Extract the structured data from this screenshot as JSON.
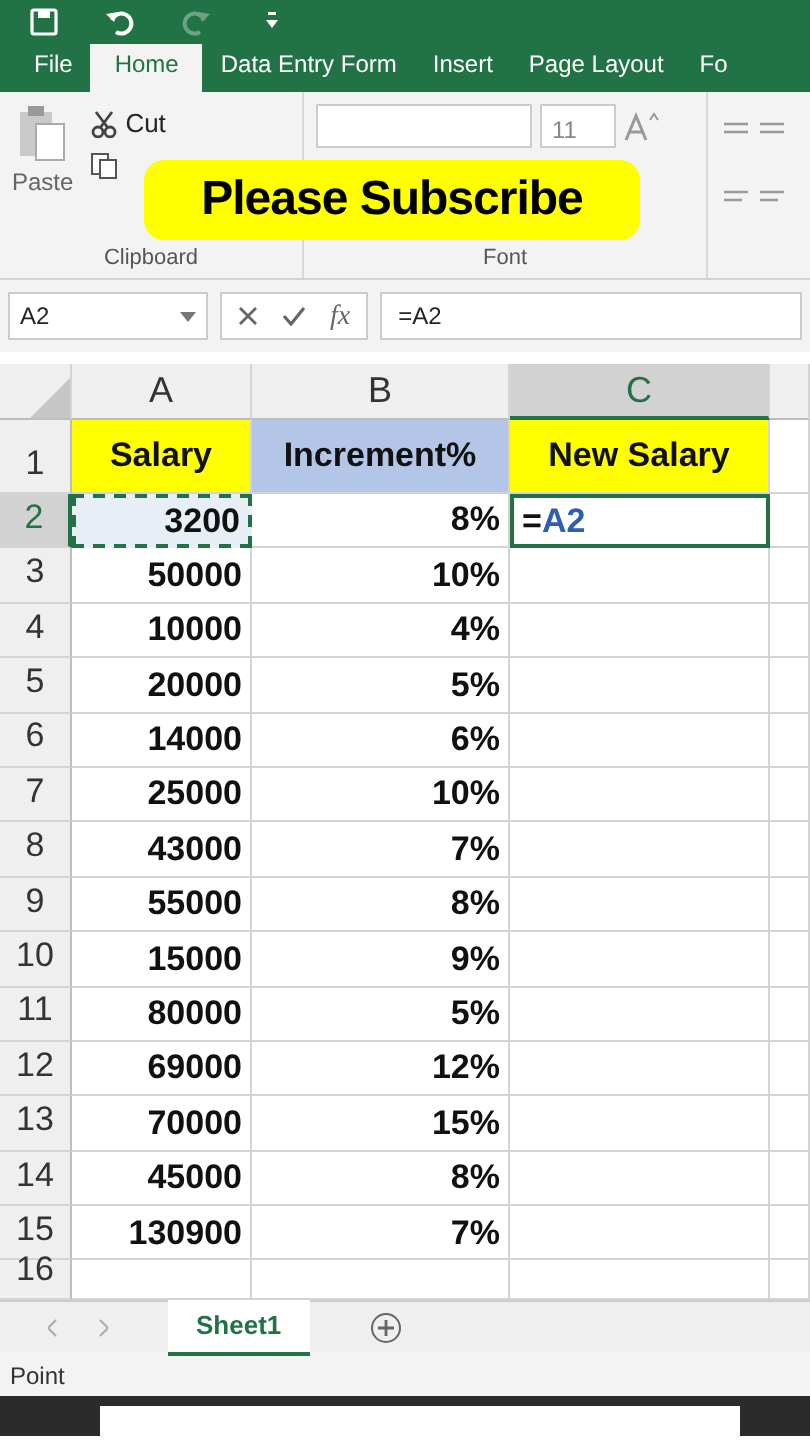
{
  "tabs": [
    {
      "label": "File",
      "selected": false
    },
    {
      "label": "Home",
      "selected": true
    },
    {
      "label": "Data Entry Form",
      "selected": false
    },
    {
      "label": "Insert",
      "selected": false
    },
    {
      "label": "Page Layout",
      "selected": false
    },
    {
      "label": "Fo",
      "selected": false
    }
  ],
  "ribbon": {
    "paste_label": "Paste",
    "cut_label": "Cut",
    "font_size": "11",
    "groups": [
      "Clipboard",
      "Font"
    ]
  },
  "overlay_banner": {
    "text": "Please Subscribe"
  },
  "formula_bar": {
    "name_box": "A2",
    "function_label": "fx",
    "value": "=A2"
  },
  "columns": [
    {
      "label": "A",
      "selected": false
    },
    {
      "label": "B",
      "selected": false
    },
    {
      "label": "C",
      "selected": true
    }
  ],
  "rows": [
    {
      "label": "1",
      "selected": false,
      "cells": [
        {
          "text": "Salary",
          "color": "#ffff00"
        },
        {
          "text": "Increment%",
          "color": "#b4c6e7"
        },
        {
          "text": "New Salary",
          "color": "#ffff00"
        }
      ]
    },
    {
      "label": "2",
      "selected": true,
      "cells": [
        {
          "text": "3200",
          "referenced": true
        },
        {
          "text": "8%"
        },
        {
          "prefix": "=",
          "ref": "A2",
          "selected": true
        }
      ]
    },
    {
      "label": "3",
      "selected": false,
      "cells": [
        {
          "text": "50000"
        },
        {
          "text": "10%"
        },
        {}
      ]
    },
    {
      "label": "4",
      "selected": false,
      "cells": [
        {
          "text": "10000"
        },
        {
          "text": "4%"
        },
        {}
      ]
    },
    {
      "label": "5",
      "selected": false,
      "cells": [
        {
          "text": "20000"
        },
        {
          "text": "5%"
        },
        {}
      ]
    },
    {
      "label": "6",
      "selected": false,
      "cells": [
        {
          "text": "14000"
        },
        {
          "text": "6%"
        },
        {}
      ]
    },
    {
      "label": "7",
      "selected": false,
      "cells": [
        {
          "text": "25000"
        },
        {
          "text": "10%"
        },
        {}
      ]
    },
    {
      "label": "8",
      "selected": false,
      "cells": [
        {
          "text": "43000"
        },
        {
          "text": "7%"
        },
        {}
      ]
    },
    {
      "label": "9",
      "selected": false,
      "cells": [
        {
          "text": "55000"
        },
        {
          "text": "8%"
        },
        {}
      ]
    },
    {
      "label": "10",
      "selected": false,
      "cells": [
        {
          "text": "15000"
        },
        {
          "text": "9%"
        },
        {}
      ]
    },
    {
      "label": "11",
      "selected": false,
      "cells": [
        {
          "text": "80000"
        },
        {
          "text": "5%"
        },
        {}
      ]
    },
    {
      "label": "12",
      "selected": false,
      "cells": [
        {
          "text": "69000"
        },
        {
          "text": "12%"
        },
        {}
      ]
    },
    {
      "label": "13",
      "selected": false,
      "cells": [
        {
          "text": "70000"
        },
        {
          "text": "15%"
        },
        {}
      ]
    },
    {
      "label": "14",
      "selected": false,
      "cells": [
        {
          "text": "45000"
        },
        {
          "text": "8%"
        },
        {}
      ]
    },
    {
      "label": "15",
      "selected": false,
      "cells": [
        {
          "text": "130900"
        },
        {
          "text": "7%"
        },
        {}
      ]
    },
    {
      "label": "16",
      "selected": false,
      "cells": [
        {},
        {},
        {}
      ]
    }
  ],
  "sheet_tabs": [
    {
      "label": "Sheet1",
      "selected": true
    }
  ],
  "status_bar": {
    "mode": "Point"
  }
}
